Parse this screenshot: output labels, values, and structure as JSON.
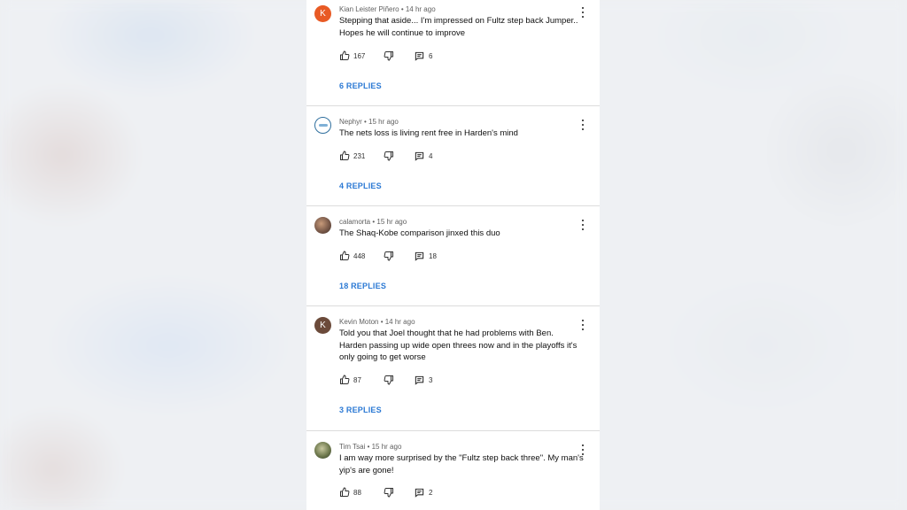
{
  "comments": [
    {
      "author": "Kian Leister Piñero",
      "time": "14 hr ago",
      "avatar_letter": "K",
      "avatar_color": "#e85a24",
      "lines": [
        "Stepping that aside... I'm impressed on Fultz step back Jumper..",
        "Hopes he will continue to improve"
      ],
      "likes": "167",
      "replies_count": "6",
      "replies_label": "6 REPLIES"
    },
    {
      "author": "Nephyr",
      "time": "15 hr ago",
      "avatar_letter": "",
      "avatar_color": "#ffffff",
      "lines": [
        "The nets loss is living rent free in Harden's mind"
      ],
      "likes": "231",
      "replies_count": "4",
      "replies_label": "4 REPLIES"
    },
    {
      "author": "calamorta",
      "time": "15 hr ago",
      "avatar_letter": "",
      "avatar_color": "#7a5a4a",
      "lines": [
        "The Shaq-Kobe comparison jinxed this duo"
      ],
      "likes": "448",
      "replies_count": "18",
      "replies_label": "18 REPLIES"
    },
    {
      "author": "Kevin Moton",
      "time": "14 hr ago",
      "avatar_letter": "K",
      "avatar_color": "#6b4a3a",
      "lines": [
        "Told you that Joel thought that he had problems with Ben.",
        "Harden passing up wide open threes now and in the playoffs it's",
        "only going to get worse"
      ],
      "likes": "87",
      "replies_count": "3",
      "replies_label": "3 REPLIES"
    },
    {
      "author": "Tim Tsai",
      "time": "15 hr ago",
      "avatar_letter": "",
      "avatar_color": "#6f7a4e",
      "lines": [
        "I am way more surprised by the \"Fultz step back three\". My man's",
        "yip's are gone!"
      ],
      "likes": "88",
      "replies_count": "2",
      "replies_label": ""
    }
  ],
  "icons": {
    "like": "thumb-up-icon",
    "dislike": "thumb-down-icon",
    "reply": "comment-icon",
    "menu": "more-vert-icon"
  }
}
